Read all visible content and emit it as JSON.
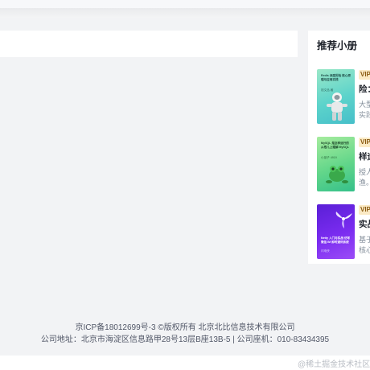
{
  "sidebar": {
    "title": "推荐小册",
    "books": [
      {
        "cover_text": "Redis 深度历险 核心原理与应用实践",
        "cover_author": "钱文品 著",
        "vip_label": "VIP",
        "title_visible": "险：",
        "desc_line1": "大型",
        "desc_line2": "实践"
      },
      {
        "cover_text": "MySQL 是怎样运行的 从根儿上理解 MySQL",
        "cover_author": "小孩子 4919",
        "vip_label": "VIP",
        "title_visible": "样运",
        "desc_line1": "授人",
        "desc_line2": "渔。"
      },
      {
        "cover_text": "Netty 入门与实战 仿写微信 IM 即时通讯系统",
        "cover_author": "闪电侠",
        "vip_label": "VIP",
        "title_visible": "实战",
        "desc_line1": "基于",
        "desc_line2": "核心"
      }
    ]
  },
  "footer": {
    "line1": "京ICP备18012699号-3 ©版权所有 北京北比信息技术有限公司",
    "line2": "公司地址：北京市海淀区信息路甲28号13层B座13B-5 | 公司座机：010-83434395"
  },
  "watermark": "@稀土掘金技术社区",
  "colors": {
    "background": "#f2f3f5",
    "card": "#ffffff",
    "vip_bg": "#fbeac5",
    "cover_redis": "#6fd6c4",
    "cover_mysql": "#6fd889",
    "cover_netty": "#7a2cf0"
  }
}
